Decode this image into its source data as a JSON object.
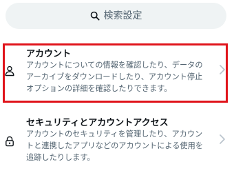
{
  "search": {
    "placeholder": "検索設定",
    "icon": "search-icon"
  },
  "items": [
    {
      "title": "アカウント",
      "description": "アカウントについての情報を確認したり、データのアーカイブをダウンロードしたり、アカウント停止オプションの詳細を確認したりできます。",
      "icon": "person-icon",
      "highlighted": true
    },
    {
      "title": "セキュリティとアカウントアクセス",
      "description": "アカウントのセキュリティを管理したり、アカウントと連携したアプリなどのアカウントによる使用を追跡したりします。",
      "icon": "lock-icon",
      "highlighted": false
    }
  ],
  "colors": {
    "highlight": "#e0131a",
    "search_bg": "#eff3f4",
    "secondary_text": "#536471",
    "primary_text": "#0f1419"
  }
}
